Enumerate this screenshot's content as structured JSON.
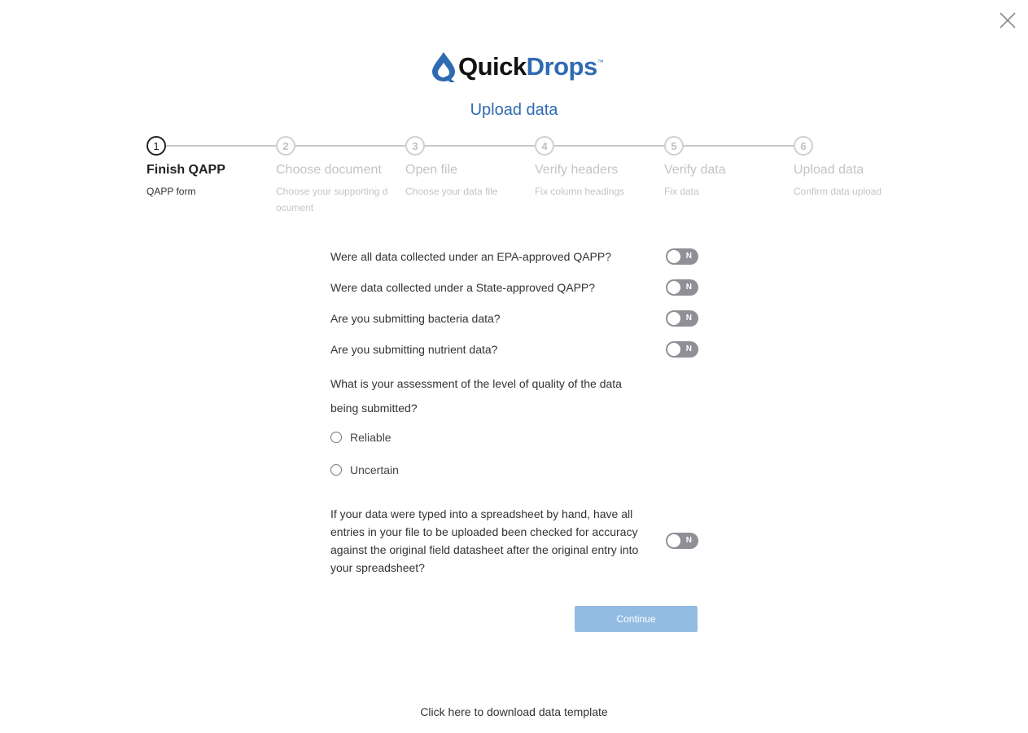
{
  "window": {
    "close_icon": "close-icon"
  },
  "logo": {
    "quick": "Quick",
    "drops": "Drops",
    "tm": "™",
    "icon": "water-drop-icon",
    "brand_color": "#2f6bb3"
  },
  "title": "Upload data",
  "steps": [
    {
      "number": "1",
      "title": "Finish QAPP",
      "subtitle": "QAPP form",
      "active": true
    },
    {
      "number": "2",
      "title": "Choose document",
      "subtitle": "Choose your supporting document",
      "active": false
    },
    {
      "number": "3",
      "title": "Open file",
      "subtitle": "Choose your data file",
      "active": false
    },
    {
      "number": "4",
      "title": "Verify headers",
      "subtitle": "Fix column headings",
      "active": false
    },
    {
      "number": "5",
      "title": "Verify data",
      "subtitle": "Fix data",
      "active": false
    },
    {
      "number": "6",
      "title": "Upload data",
      "subtitle": "Confirm data upload",
      "active": false
    }
  ],
  "questions": [
    {
      "text": "Were all data collected under an EPA-approved QAPP?",
      "toggle": "N"
    },
    {
      "text": "Were data collected under a State-approved QAPP?",
      "toggle": "N"
    },
    {
      "text": "Are you submitting bacteria data?",
      "toggle": "N"
    },
    {
      "text": "Are you submitting nutrient data?",
      "toggle": "N"
    }
  ],
  "assessment": {
    "question": "What is your assessment of the level of quality of the data being submitted?",
    "options": [
      "Reliable",
      "Uncertain"
    ]
  },
  "hand_entry": {
    "text": "If your data were typed into a spreadsheet by hand, have all entries in your file to be uploaded been checked for accuracy against the original field datasheet after the original entry into your spreadsheet?",
    "toggle": "N"
  },
  "continue_label": "Continue",
  "template_link": "Click here to download data template"
}
